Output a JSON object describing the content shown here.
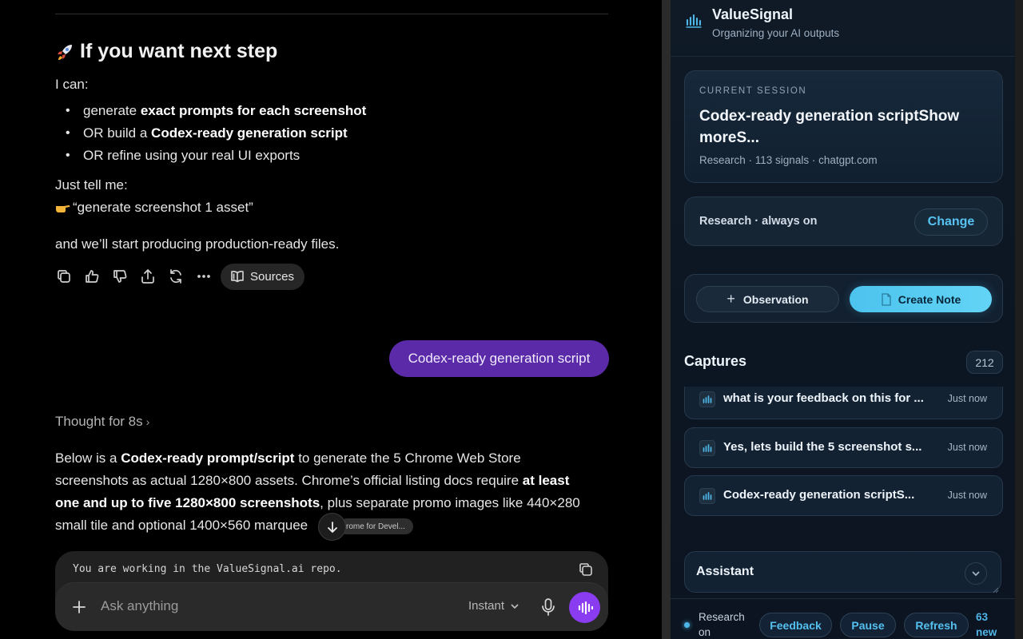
{
  "chat": {
    "heading": "If you want next step",
    "intro": "I can:",
    "bullets": [
      {
        "pre": "generate ",
        "bold": "exact prompts for each screenshot",
        "post": ""
      },
      {
        "pre": "OR build a ",
        "bold": "Codex-ready generation script",
        "post": ""
      },
      {
        "pre": "OR refine using your real UI exports",
        "bold": "",
        "post": ""
      }
    ],
    "tell": "Just tell me:",
    "example": "“generate screenshot 1 asset”",
    "closing": "and we’ll start producing production-ready files.",
    "sources_label": "Sources",
    "user_message": "Codex-ready generation script",
    "thought_label": "Thought for 8s",
    "response": [
      {
        "a": "Below is a ",
        "b": "Codex-ready prompt/script",
        "c": " to generate the 5 Chrome Web Store"
      },
      {
        "a": "screenshots as actual 1280×800 assets. Chrome’s official listing docs require ",
        "b": "at least",
        "c": ""
      },
      {
        "a": "",
        "b": "one and up to five 1280×800 screenshots",
        "c": ", plus separate promo images like 440×280"
      },
      {
        "a": "small tile and optional 1400×560 marquee",
        "b": "",
        "c": ""
      }
    ],
    "tooltip_chip": "rome for Devel...",
    "composer_code": "You are working in the ValueSignal.ai repo.",
    "composer_placeholder": "Ask anything",
    "model_label": "Instant"
  },
  "panel": {
    "brand": "ValueSignal",
    "tagline": "Organizing your AI outputs",
    "session_label": "CURRENT SESSION",
    "session_title": "Codex-ready generation scriptShow moreS...",
    "session_meta": "Research · 113 signals · chatgpt.com",
    "mode_text": "Research · always on",
    "change_label": "Change",
    "observation_label": "Observation",
    "create_note_label": "Create Note",
    "captures_title": "Captures",
    "captures_count": "212",
    "captures": [
      {
        "title": "what is your feedback on this for ...",
        "time": "Just now"
      },
      {
        "title": "Yes, lets build the 5 screenshot s...",
        "time": "Just now"
      },
      {
        "title": "Codex-ready generation scriptS...",
        "time": "Just now"
      }
    ],
    "assistant_label": "Assistant",
    "status_text": "Research on",
    "feedback_label": "Feedback",
    "pause_label": "Pause",
    "refresh_label": "Refresh",
    "new_count": "63 new"
  },
  "colors": {
    "accent": "#4fb6e8",
    "user_bubble": "#5b2aa8",
    "voice_button": "#8a3cf0",
    "panel_bg": "#0f1a26"
  }
}
